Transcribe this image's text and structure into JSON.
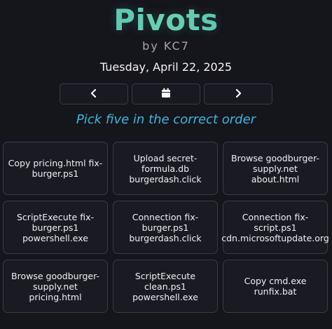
{
  "header": {
    "title": "Pivots",
    "byline": "by KC7",
    "date": "Tuesday, April 22, 2025"
  },
  "nav": {
    "prev_icon": "chevron-left-icon",
    "calendar_icon": "calendar-icon",
    "next_icon": "chevron-right-icon"
  },
  "instruction": "Pick five in the correct order",
  "colors": {
    "title_gradient": "#5ccdb0",
    "instruction": "#3bb6de",
    "background": "#15151c",
    "card_border": "#3a3a48"
  },
  "cards": [
    {
      "label": "Copy pricing.html fix-burger.ps1"
    },
    {
      "label": "Upload secret-formula.db burgerdash.click"
    },
    {
      "label": "Browse goodburger-supply.net about.html"
    },
    {
      "label": "ScriptExecute fix-burger.ps1 powershell.exe"
    },
    {
      "label": "Connection fix-burger.ps1 burgerdash.click"
    },
    {
      "label": "Connection fix-script.ps1 cdn.microsoftupdate.org"
    },
    {
      "label": "Browse goodburger-supply.net pricing.html"
    },
    {
      "label": "ScriptExecute clean.ps1 powershell.exe"
    },
    {
      "label": "Copy cmd.exe runfix.bat"
    }
  ]
}
